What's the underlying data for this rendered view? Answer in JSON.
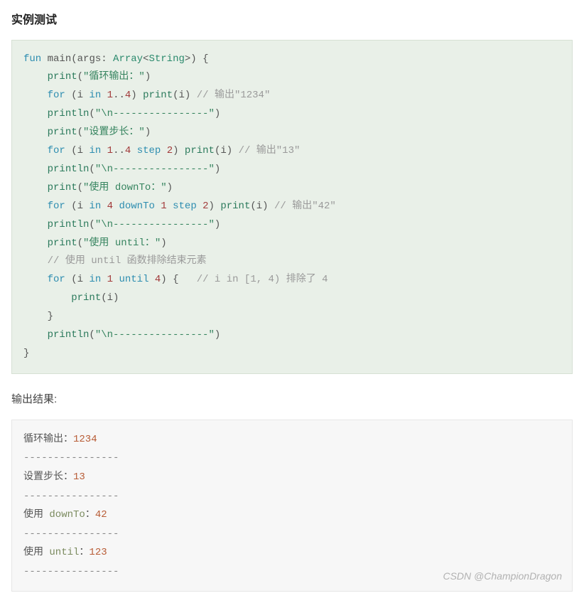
{
  "section_title": "实例测试",
  "code": {
    "l1": {
      "kw_fun": "fun",
      "main": " main",
      "args": "(args: ",
      "arr": "Array",
      "lt": "<",
      "str_t": "String",
      "gt": ">",
      "close": ") {"
    },
    "l2": {
      "indent": "    ",
      "fn": "print",
      "open": "(",
      "str": "\"循环输出：\"",
      "close": ")"
    },
    "l3": {
      "indent": "    ",
      "kw_for": "for",
      "open": " (i ",
      "kw_in": "in",
      "sp": " ",
      "n1": "1",
      "dots": "..",
      "n2": "4",
      "close": ") ",
      "fn": "print",
      "arg": "(i)",
      "sp2": " ",
      "cm": "// 输出\"1234\""
    },
    "l4": {
      "indent": "    ",
      "fn": "println",
      "open": "(",
      "str": "\"\\n----------------\"",
      "close": ")"
    },
    "l5": {
      "indent": "    ",
      "fn": "print",
      "open": "(",
      "str": "\"设置步长：\"",
      "close": ")"
    },
    "l6": {
      "indent": "    ",
      "kw_for": "for",
      "open": " (i ",
      "kw_in": "in",
      "sp": " ",
      "n1": "1",
      "dots": "..",
      "n2": "4",
      "sp2": " ",
      "kw_step": "step",
      "sp3": " ",
      "n3": "2",
      "close": ") ",
      "fn": "print",
      "arg": "(i)",
      "sp4": " ",
      "cm": "// 输出\"13\""
    },
    "l7": {
      "indent": "    ",
      "fn": "println",
      "open": "(",
      "str": "\"\\n----------------\"",
      "close": ")"
    },
    "l8": {
      "indent": "    ",
      "fn": "print",
      "open": "(",
      "str": "\"使用 downTo：\"",
      "close": ")"
    },
    "l9": {
      "indent": "    ",
      "kw_for": "for",
      "open": " (i ",
      "kw_in": "in",
      "sp": " ",
      "n1": "4",
      "sp2": " ",
      "kw_dt": "downTo",
      "sp3": " ",
      "n2": "1",
      "sp4": " ",
      "kw_step": "step",
      "sp5": " ",
      "n3": "2",
      "close": ") ",
      "fn": "print",
      "arg": "(i)",
      "sp6": " ",
      "cm": "// 输出\"42\""
    },
    "l10": {
      "indent": "    ",
      "fn": "println",
      "open": "(",
      "str": "\"\\n----------------\"",
      "close": ")"
    },
    "l11": {
      "indent": "    ",
      "fn": "print",
      "open": "(",
      "str": "\"使用 until：\"",
      "close": ")"
    },
    "l12": {
      "indent": "    ",
      "cm": "// 使用 until 函数排除结束元素"
    },
    "l13": {
      "indent": "    ",
      "kw_for": "for",
      "open": " (i ",
      "kw_in": "in",
      "sp": " ",
      "n1": "1",
      "sp2": " ",
      "kw_until": "until",
      "sp3": " ",
      "n2": "4",
      "close": ") {   ",
      "cm": "// i in [1, 4) 排除了 4"
    },
    "l14": {
      "indent": "        ",
      "fn": "print",
      "arg": "(i)"
    },
    "l15": {
      "indent": "    ",
      "brace": "}"
    },
    "l16": {
      "indent": "    ",
      "fn": "println",
      "open": "(",
      "str": "\"\\n----------------\"",
      "close": ")"
    },
    "l17": {
      "brace": "}"
    }
  },
  "result_label": "输出结果:",
  "output": {
    "r1": {
      "label": "循环输出：",
      "val": "1234"
    },
    "sep": "----------------",
    "r2": {
      "label": "设置步长：",
      "val": "13"
    },
    "r3": {
      "label": "使用 ",
      "kw": "downTo",
      "colon": "：",
      "val": "42"
    },
    "r4": {
      "label": "使用 ",
      "kw": "until",
      "colon": "：",
      "val": "123"
    }
  },
  "watermark": "CSDN @ChampionDragon"
}
